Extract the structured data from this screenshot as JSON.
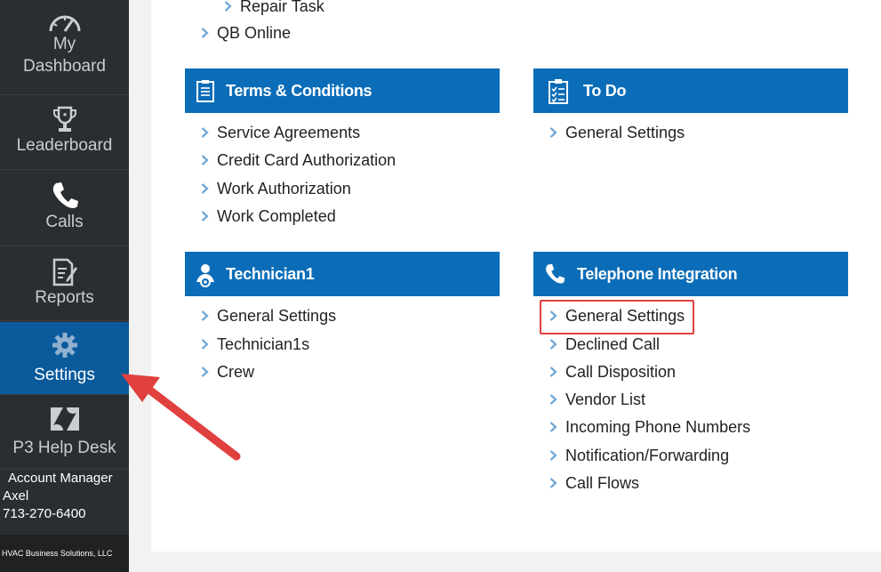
{
  "sidebar": {
    "items": [
      {
        "label_line1": "My",
        "label_line2": "Dashboard",
        "icon": "gauge-icon"
      },
      {
        "label": "Leaderboard",
        "icon": "trophy-icon"
      },
      {
        "label": "Calls",
        "icon": "phone-icon"
      },
      {
        "label": "Reports",
        "icon": "report-icon"
      },
      {
        "label": "Settings",
        "icon": "gear-icon"
      },
      {
        "label": "P3 Help Desk",
        "icon": "zendesk-icon"
      }
    ],
    "active": "Settings",
    "account": {
      "role": "Account Manager",
      "name": "Axel",
      "phone": "713-270-6400"
    },
    "footer": "HVAC Business Solutions, LLC"
  },
  "top_links": {
    "repair_task": "Repair Task",
    "qb_online": "QB Online"
  },
  "sections": {
    "terms": {
      "title": "Terms & Conditions",
      "icon": "clipboard-icon",
      "links": [
        "Service Agreements",
        "Credit Card Authorization",
        "Work Authorization",
        "Work Completed"
      ]
    },
    "todo": {
      "title": "To Do",
      "icon": "checklist-icon",
      "links": [
        "General Settings"
      ]
    },
    "technician": {
      "title": "Technician1",
      "icon": "technician-icon",
      "links": [
        "General Settings",
        "Technician1s",
        "Crew"
      ]
    },
    "telephone": {
      "title": "Telephone Integration",
      "icon": "phone-icon",
      "links": [
        "General Settings",
        "Declined Call",
        "Call Disposition",
        "Vendor List",
        "Incoming Phone Numbers",
        "Notification/Forwarding",
        "Call Flows"
      ],
      "highlighted": "General Settings"
    }
  },
  "colors": {
    "sidebar_bg": "#2b2e31",
    "active_bg": "#0a5a9c",
    "header_blue": "#0b6db8",
    "chevron": "#6ea6d6",
    "annotation_red": "#e0403e"
  }
}
